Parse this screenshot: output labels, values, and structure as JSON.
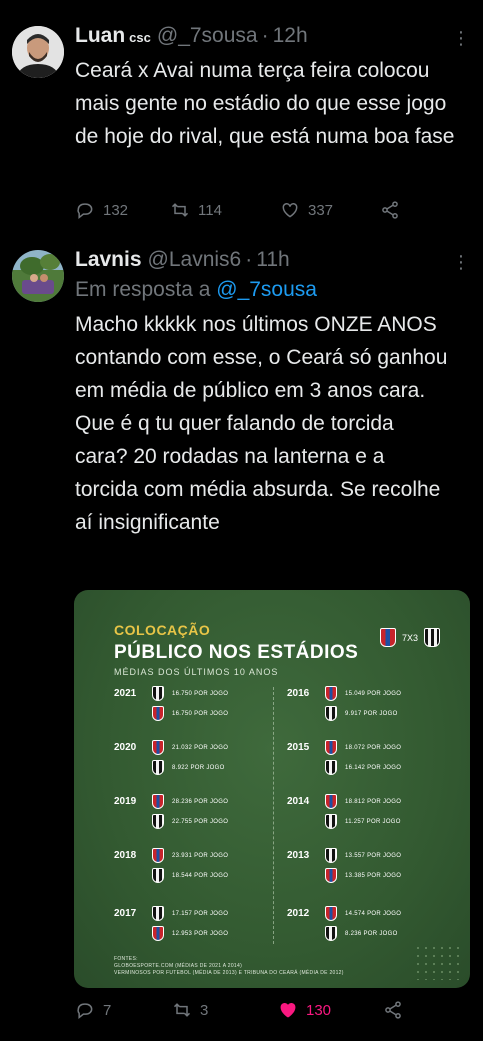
{
  "tweet1": {
    "name": "Luan",
    "badge": "csc",
    "handle": "@_7sousa",
    "time": "12h",
    "dot": "·",
    "text": "Ceará x Avai numa terça feira colocou mais gente no estádio do que esse jogo de hoje do rival, que está numa boa fase",
    "replies": "132",
    "retweets": "114",
    "likes": "337"
  },
  "tweet2": {
    "name": "Lavnis",
    "handle": "@Lavnis6",
    "time": "11h",
    "dot": "·",
    "reply_prefix": "Em resposta a",
    "reply_mention": "@_7sousa",
    "text": "Macho kkkkk nos últimos ONZE ANOS contando com esse, o Ceará só ganhou em média de público em 3 anos cara. Que é q tu quer falando de torcida cara? 20 rodadas na lanterna e a torcida com média absurda. Se recolhe aí insignificante",
    "replies": "7",
    "retweets": "3",
    "likes": "130",
    "like_color": "#f91880"
  },
  "card": {
    "subtitle_top": "COLOCAÇÃO",
    "title": "PÚBLICO NOS ESTÁDIOS",
    "subtitle": "MÉDIAS DOS ÚLTIMOS 10 ANOS",
    "score": "7X3",
    "years_left": [
      {
        "year": "2021",
        "first": {
          "club": "ceara",
          "value": "16.750 POR JOGO"
        },
        "second": {
          "club": "fortaleza",
          "value": "16.750 POR JOGO"
        }
      },
      {
        "year": "2020",
        "first": {
          "club": "fortaleza",
          "value": "21.032 POR JOGO"
        },
        "second": {
          "club": "ceara",
          "value": "8.922 POR JOGO"
        }
      },
      {
        "year": "2019",
        "first": {
          "club": "fortaleza",
          "value": "28.236 POR JOGO"
        },
        "second": {
          "club": "ceara",
          "value": "22.755 POR JOGO"
        }
      },
      {
        "year": "2018",
        "first": {
          "club": "fortaleza",
          "value": "23.931 POR JOGO"
        },
        "second": {
          "club": "ceara",
          "value": "18.544 POR JOGO"
        }
      },
      {
        "year": "2017",
        "first": {
          "club": "ceara",
          "value": "17.157 POR JOGO"
        },
        "second": {
          "club": "fortaleza",
          "value": "12.953 POR JOGO"
        }
      }
    ],
    "years_right": [
      {
        "year": "2016",
        "first": {
          "club": "fortaleza",
          "value": "15.049 POR JOGO"
        },
        "second": {
          "club": "ceara",
          "value": "9.917 POR JOGO"
        }
      },
      {
        "year": "2015",
        "first": {
          "club": "fortaleza",
          "value": "18.072 POR JOGO"
        },
        "second": {
          "club": "ceara",
          "value": "16.142 POR JOGO"
        }
      },
      {
        "year": "2014",
        "first": {
          "club": "fortaleza",
          "value": "18.812 POR JOGO"
        },
        "second": {
          "club": "ceara",
          "value": "11.257 POR JOGO"
        }
      },
      {
        "year": "2013",
        "first": {
          "club": "ceara",
          "value": "13.557 POR JOGO"
        },
        "second": {
          "club": "fortaleza",
          "value": "13.385 POR JOGO"
        }
      },
      {
        "year": "2012",
        "first": {
          "club": "fortaleza",
          "value": "14.574 POR JOGO"
        },
        "second": {
          "club": "ceara",
          "value": "8.236 POR JOGO"
        }
      }
    ],
    "sources_title": "FONTES:",
    "sources_line1": "GLOBOESPORTE.COM (MÉDIAS DE 2021 A 2014)",
    "sources_line2": "VERMINOSOS POR FUTEBOL (MÉDIA DE 2013) E TRIBUNA DO CEARÁ (MÉDIA DE 2012)"
  }
}
